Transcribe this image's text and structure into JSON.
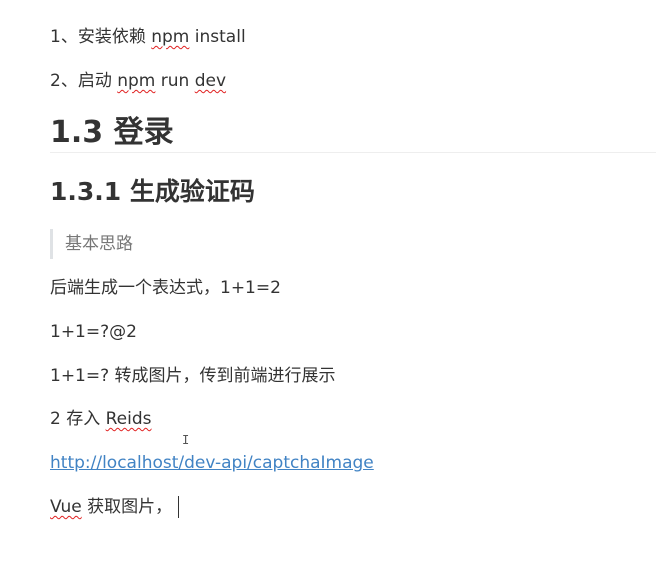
{
  "editor": {
    "step1_prefix": "1、安装依赖 ",
    "step1_npm": "npm",
    "step1_suffix": " install",
    "step2_prefix": "2、启动 ",
    "step2_npm": "npm",
    "step2_mid": " run ",
    "step2_dev": "dev",
    "heading_login": "1.3 登录",
    "heading_captcha": "1.3.1 生成验证码",
    "quote_text": "基本思路",
    "para_expression": "后端生成一个表达式，1+1=2",
    "para_format": "1+1=?@2",
    "para_convert": "1+1=? 转成图片，传到前端进行展示",
    "para_store_prefix": "2 存入 ",
    "para_store_word": "Reids",
    "link_url": "http://localhost/dev-api/captchaImage",
    "para_vue_word": "Vue",
    "para_vue_suffix": " 获取图片，",
    "cursor_icon": "i-beam-cursor-icon",
    "colors": {
      "text": "#333333",
      "link": "#4183c4",
      "spellcheck": "#e02020",
      "quote_border": "#dfe2e5",
      "quote_text": "#777777"
    }
  }
}
